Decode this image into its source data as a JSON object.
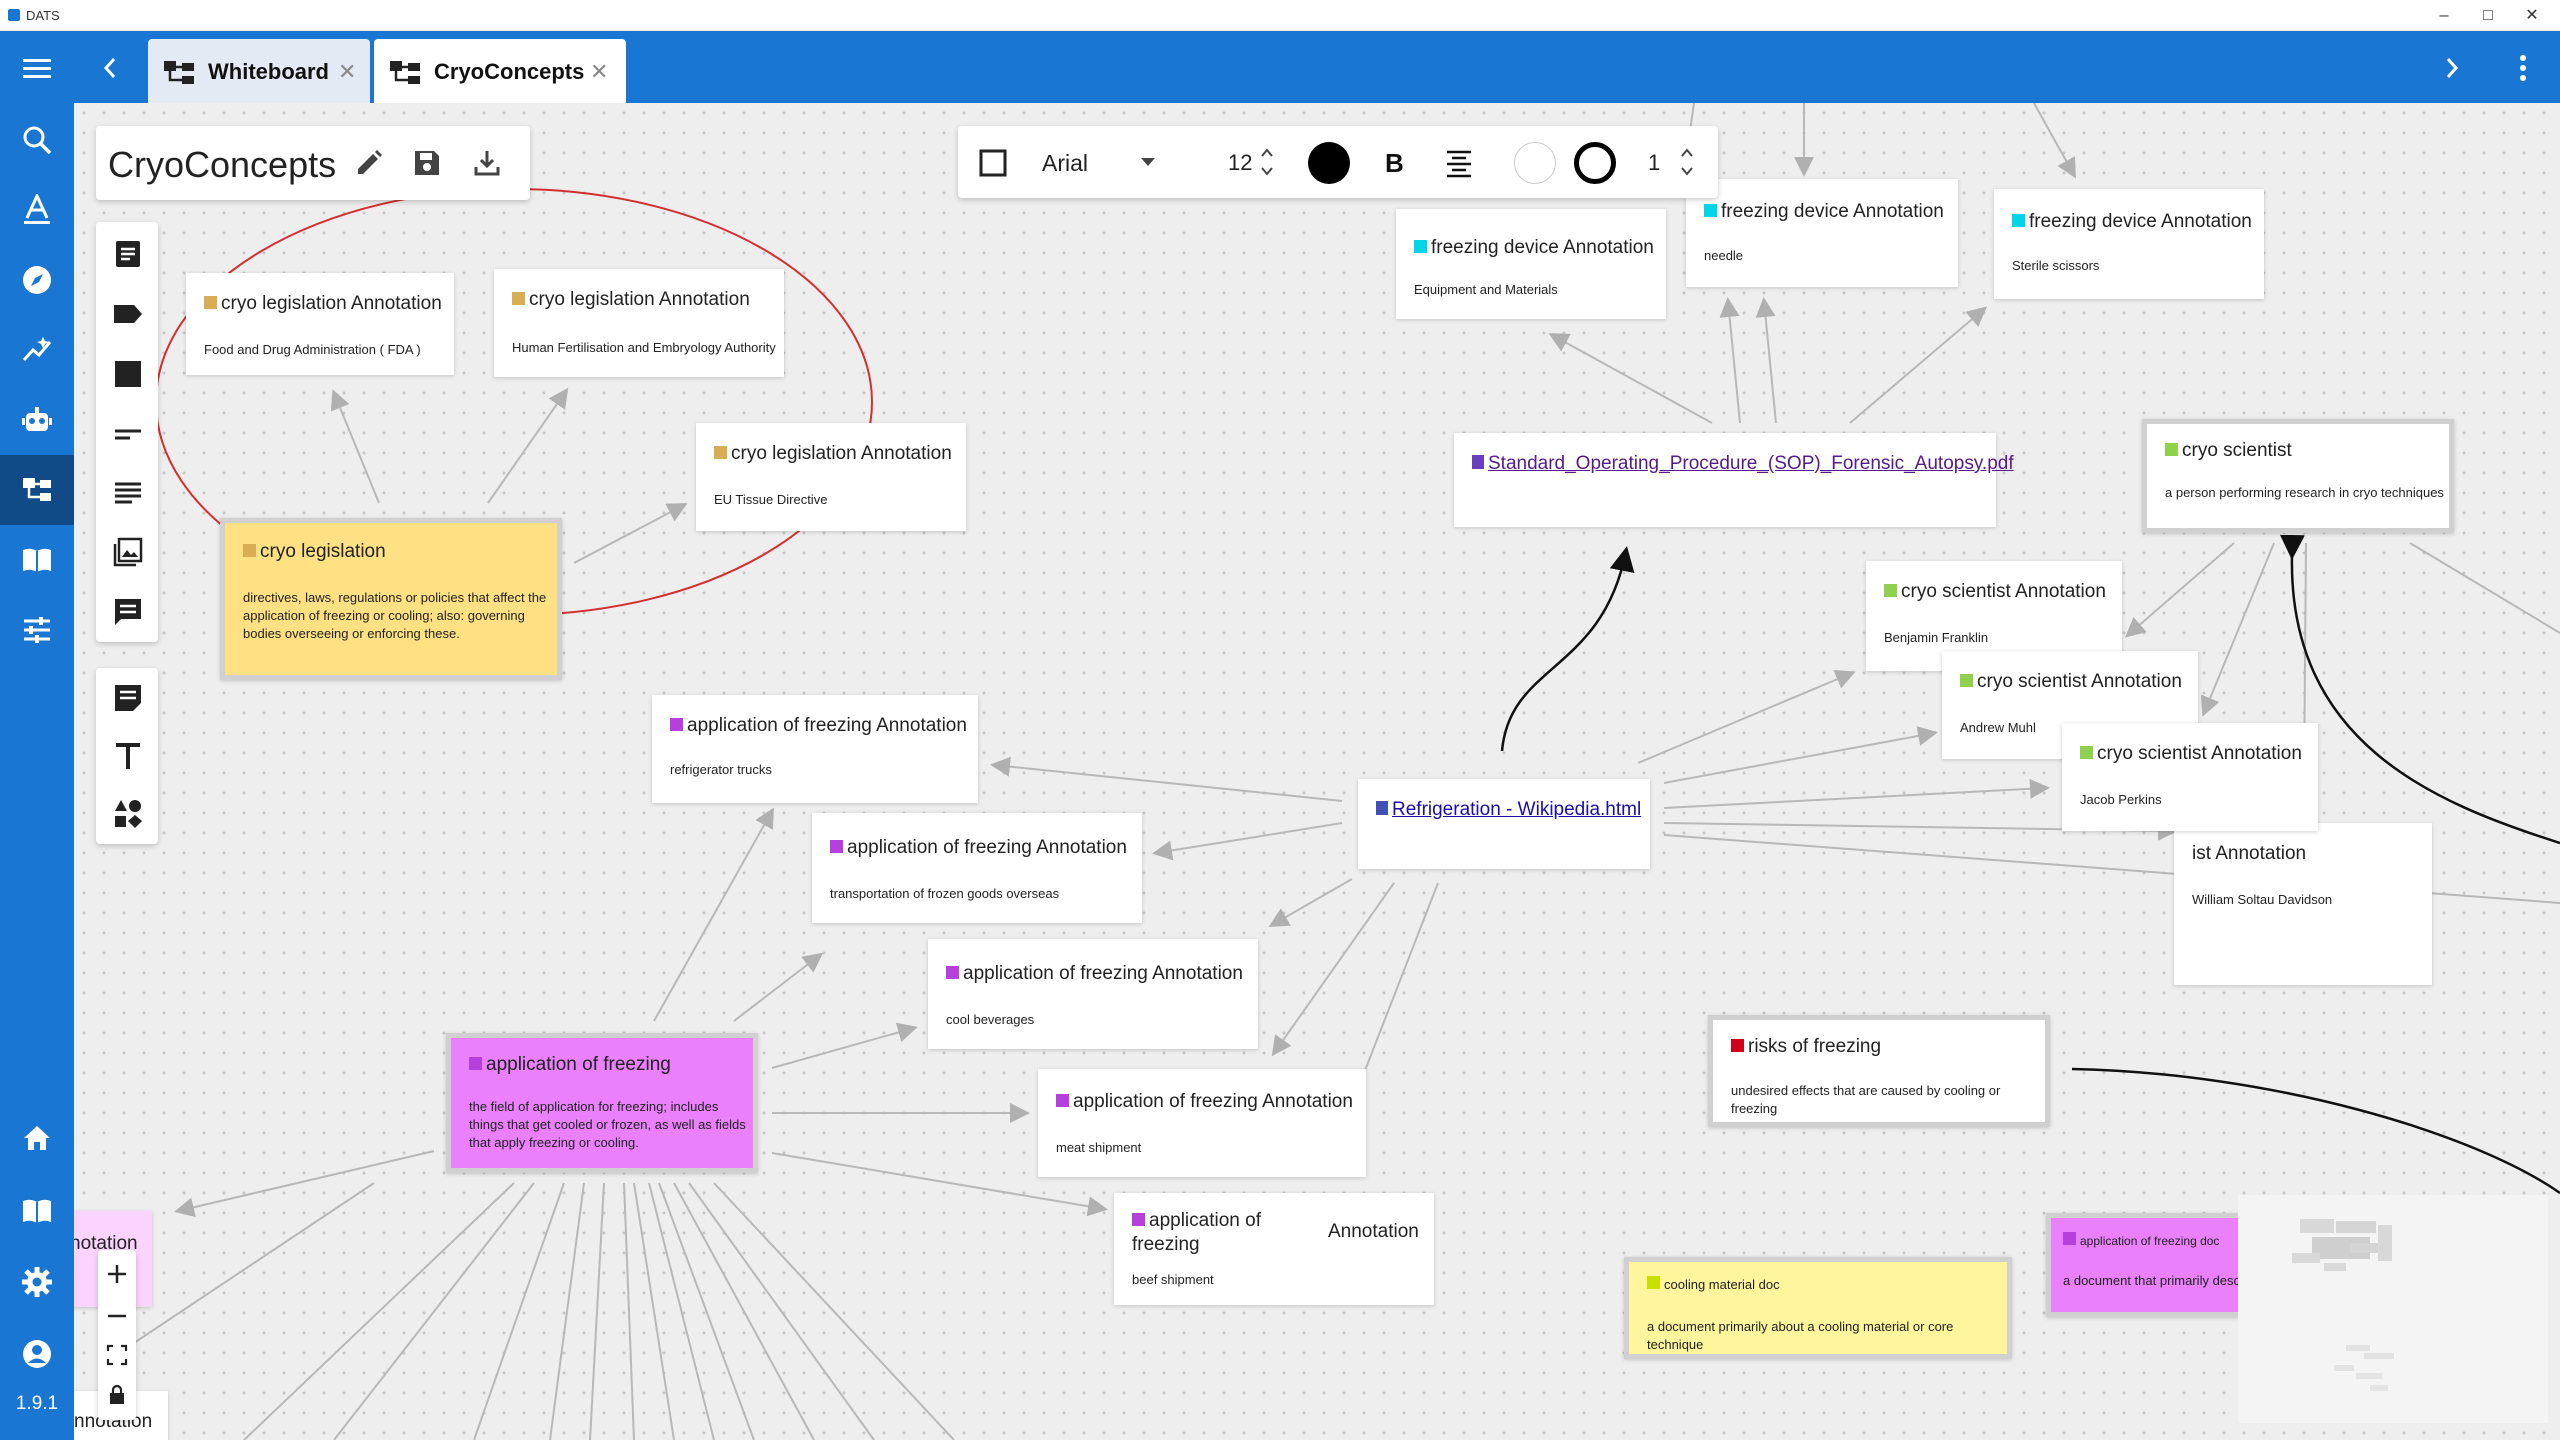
{
  "window": {
    "title": "DATS"
  },
  "tabs": [
    {
      "label": "Whiteboard"
    },
    {
      "label": "CryoConcepts"
    }
  ],
  "sidebar": {
    "items": [
      {
        "icon": "search-icon"
      },
      {
        "icon": "annotation-icon"
      },
      {
        "icon": "explore-icon"
      },
      {
        "icon": "analysis-icon"
      },
      {
        "icon": "robot-icon"
      },
      {
        "icon": "whiteboard-icon"
      },
      {
        "icon": "logbook-icon"
      },
      {
        "icon": "settings-sliders-icon"
      },
      {
        "icon": "home-icon"
      },
      {
        "icon": "docs-icon"
      },
      {
        "icon": "gear-icon"
      },
      {
        "icon": "account-icon"
      }
    ],
    "version": "1.9.1"
  },
  "whiteboard": {
    "title": "CryoConcepts"
  },
  "format_toolbar": {
    "font": "Arial",
    "font_size": "12",
    "stroke_width": "1",
    "text_color": "#000000",
    "fill_color": "#ffffff"
  },
  "nodes": {
    "legis1": {
      "title": "cryo legislation Annotation",
      "desc": "Food and Drug Administration ( FDA )"
    },
    "legis2": {
      "title": "cryo legislation Annotation",
      "desc": "Human Fertilisation and Embryology Authority"
    },
    "legis3": {
      "title": "cryo legislation Annotation",
      "desc": "EU Tissue Directive"
    },
    "legis_code": {
      "title": "cryo legislation",
      "desc": "directives, laws, regulations or policies that affect the application of freezing or cooling; also: governing bodies overseeing or enforcing these."
    },
    "fd1": {
      "title": "freezing device Annotation",
      "desc": "Equipment and Materials"
    },
    "fd2": {
      "title": "freezing device Annotation",
      "desc": "needle"
    },
    "fd3": {
      "title": "freezing device Annotation",
      "desc": "Sterile scissors"
    },
    "sop": {
      "label": "Standard_Operating_Procedure_(SOP)_Forensic_Autopsy.pdf"
    },
    "sci_code": {
      "title": "cryo scientist",
      "desc": "a person performing research in cryo techniques"
    },
    "sci1": {
      "title": "cryo scientist Annotation",
      "desc": "Benjamin Franklin"
    },
    "sci2": {
      "title": "cryo scientist Annotation",
      "desc": "Andrew Muhl"
    },
    "sci3": {
      "title": "cryo scientist Annotation",
      "desc": "Jacob Perkins"
    },
    "sci4": {
      "title": "ist Annotation",
      "desc": "William Soltau Davidson"
    },
    "wiki": {
      "label": "Refrigeration - Wikipedia.html"
    },
    "app1": {
      "title": "application of freezing Annotation",
      "desc": "refrigerator trucks"
    },
    "app2": {
      "title": "application of freezing Annotation",
      "desc": "transportation of frozen goods overseas"
    },
    "app3": {
      "title": "application of freezing Annotation",
      "desc": "cool beverages"
    },
    "app4": {
      "title": "application of freezing Annotation",
      "desc": "meat shipment"
    },
    "app5": {
      "title": "application of freezing",
      "title_right": "Annotation",
      "desc": "beef shipment"
    },
    "app_code": {
      "title": "application of freezing",
      "desc": "the field of application for freezing; includes things that get cooled or frozen, as well as fields that apply freezing or cooling."
    },
    "risks": {
      "title": "risks of freezing",
      "desc": "undesired effects that are caused by cooling or freezing"
    },
    "cool_doc": {
      "title": "cooling material doc",
      "desc": "a document primarily about a cooling material or core technique"
    },
    "app_doc": {
      "title": "application of freezing doc",
      "desc": "a document that primarily desc"
    },
    "left_partial": {
      "title": "notation"
    },
    "bottom_partial": {
      "title": "nnotation"
    }
  },
  "colors": {
    "primary": "#1976d2",
    "legislation": "#d9ad54",
    "legislation_bg": "#ffe082",
    "freezing_device": "#00d6e8",
    "scientist": "#8fd14f",
    "application": "#b640dd",
    "application_bg": "#ea80fc",
    "risks": "#d0021b",
    "cooling_doc": "#c7e000",
    "cooling_doc_bg": "#fff59d",
    "document_icon": "#6a3fbd",
    "wiki_icon": "#3f51b5"
  }
}
